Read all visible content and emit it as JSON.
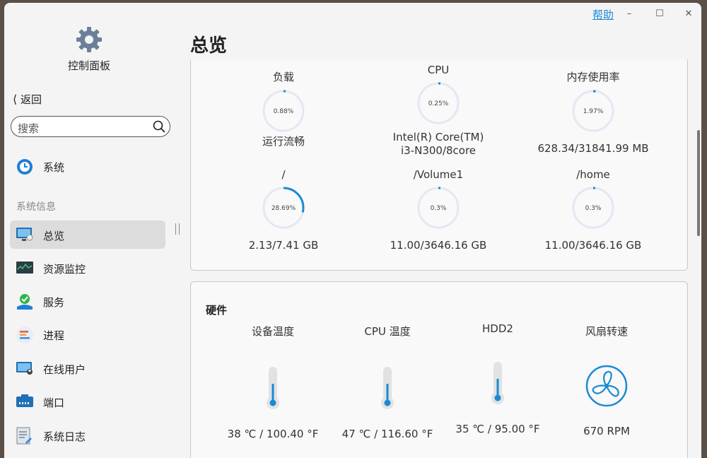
{
  "window": {
    "help": "帮助",
    "minimize": "–",
    "maximize": "☐",
    "close": "✕"
  },
  "sidebar": {
    "app_title": "控制面板",
    "back": "返回",
    "search_placeholder": "搜索",
    "section": "系统信息",
    "items": [
      {
        "label": "系统",
        "icon": "system-icon"
      },
      {
        "label": "总览",
        "icon": "overview-icon",
        "active": true
      },
      {
        "label": "资源监控",
        "icon": "resource-monitor-icon"
      },
      {
        "label": "服务",
        "icon": "services-icon"
      },
      {
        "label": "进程",
        "icon": "process-icon"
      },
      {
        "label": "在线用户",
        "icon": "online-users-icon"
      },
      {
        "label": "端口",
        "icon": "port-icon"
      },
      {
        "label": "系统日志",
        "icon": "system-log-icon"
      }
    ]
  },
  "main": {
    "title": "总览",
    "gauges": [
      {
        "label": "负载",
        "value": "0.88%",
        "fraction": 0.0088,
        "sub": "运行流畅"
      },
      {
        "label": "CPU",
        "value": "0.25%",
        "fraction": 0.0025,
        "sub": "Intel(R) Core(TM) i3-N300/8core"
      },
      {
        "label": "内存使用率",
        "value": "1.97%",
        "fraction": 0.0197,
        "sub": "628.34/31841.99 MB"
      },
      {
        "label": "/",
        "value": "28.69%",
        "fraction": 0.2869,
        "sub": "2.13/7.41 GB"
      },
      {
        "label": "/Volume1",
        "value": "0.3%",
        "fraction": 0.003,
        "sub": "11.00/3646.16 GB"
      },
      {
        "label": "/home",
        "value": "0.3%",
        "fraction": 0.003,
        "sub": "11.00/3646.16 GB"
      }
    ],
    "hardware": {
      "title": "硬件",
      "items": [
        {
          "label": "设备温度",
          "value": "38 ℃ / 100.40 °F",
          "icon": "thermometer-icon"
        },
        {
          "label": "CPU 温度",
          "value": "47 ℃ / 116.60 °F",
          "icon": "thermometer-icon"
        },
        {
          "label": "HDD2",
          "value": "35 ℃ / 95.00 °F",
          "icon": "thermometer-icon"
        },
        {
          "label": "风扇转速",
          "value": "670 RPM",
          "icon": "fan-icon"
        }
      ]
    }
  },
  "colors": {
    "accent": "#1a8ad4",
    "ring": "#e3e8f3"
  }
}
